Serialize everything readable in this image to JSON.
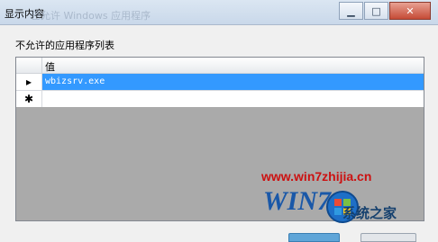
{
  "window": {
    "title": "显示内容",
    "ghost_title": "已允许 Windows 应用程序",
    "controls": [
      "minimize-icon",
      "maximize-icon",
      "close-icon"
    ]
  },
  "dialog": {
    "label": "不允许的应用程序列表"
  },
  "grid": {
    "column_header": "值",
    "rows": [
      {
        "marker": "▸",
        "value": "wbizsrv.exe",
        "selected": true
      },
      {
        "marker": "✱",
        "value": "",
        "selected": false
      }
    ]
  },
  "watermark": {
    "url": "www.win7zhijia.cn",
    "logo": "WIN7",
    "site": "系统之家"
  }
}
